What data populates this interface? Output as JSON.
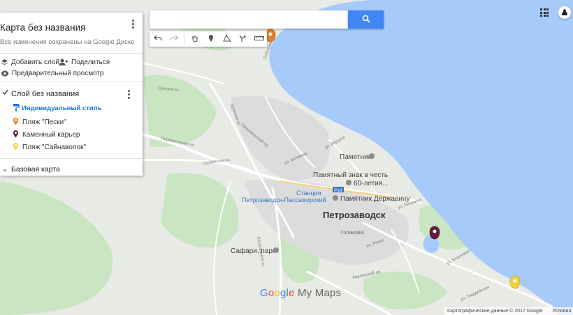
{
  "panel": {
    "title": "Карта без названия",
    "subtitle": "Все изменения сохранены на Google Диске",
    "add_layer": "Добавить слой",
    "share": "Поделиться",
    "preview": "Предварительный просмотр",
    "layer_name": "Слой без названия",
    "style_link": "Индивидуальный стиль",
    "places": [
      {
        "label": "Пляж \"Пески\"",
        "color": "#e67c22"
      },
      {
        "label": "Каменный карьер",
        "color": "#6a1b3a"
      },
      {
        "label": "Пляж \"Сайнаволок\"",
        "color": "#f4d03f"
      }
    ],
    "basemap": "Базовая карта"
  },
  "search": {
    "placeholder": ""
  },
  "toolbar": {
    "icons": [
      "undo-icon",
      "redo-icon",
      "hand-icon",
      "marker-icon",
      "draw-line-icon",
      "directions-icon",
      "ruler-icon"
    ]
  },
  "map": {
    "city": "Петрозаводск",
    "places": {
      "monument": "Памятник",
      "sign": "Памятный знак в честь",
      "sign2": "60-летия...",
      "derzhavin": "Памятник Державину",
      "station": "Станция",
      "station2": "Петрозаводск-Пассажирский",
      "safari": "Сафари, парк",
      "road_badge": "P19"
    },
    "streets": {
      "sunskoe": "Сунское ш.",
      "suoyarvsky": "Суоярвское ш.",
      "pereval": "Перевалочная ул.",
      "shuyskoe": "Шуйское ш.",
      "pereval2": "Перевальский пр.",
      "verkhus": "ул. Веркуса",
      "shotman": "ул. Шотмана",
      "golikovka": "Голиковка",
      "lososinskoe": "Лососинское ш.",
      "karelsky": "Карельский пр.",
      "rovio": "ул. Ровио",
      "klyuchevaya": "ул. Ключевая",
      "rigachina": "ул. Ригачина",
      "sobolev": "Соболева",
      "gvardeyskaya": "ул. Гвардейская"
    }
  },
  "logo": {
    "g1": "G",
    "g2": "o",
    "g3": "o",
    "g4": "g",
    "g5": "l",
    "g6": "e",
    "mymaps": "My Maps"
  },
  "attribution": {
    "data": "Картографические данные © 2017 Google",
    "terms": "Условия"
  },
  "colors": {
    "water": "#a6cbfb",
    "land": "#e8eae6",
    "green": "#c5e8c0",
    "accent": "#4285f4"
  }
}
